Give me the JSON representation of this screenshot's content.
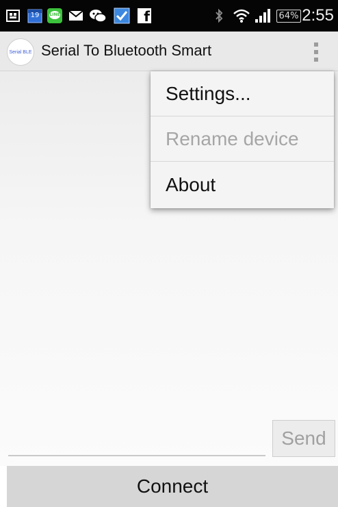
{
  "status_bar": {
    "calendar_day": "19",
    "line_label": "LINE",
    "facebook_glyph": "f",
    "battery": "64%",
    "time": "2:55",
    "icons": [
      "screenshot-icon",
      "calendar-icon",
      "line-app-icon",
      "mail-icon",
      "wechat-icon",
      "task-check-icon",
      "facebook-icon",
      "bluetooth-icon",
      "wifi-icon",
      "signal-icon",
      "battery-icon"
    ]
  },
  "app_bar": {
    "logo_text": "Serial BLE",
    "title": "Serial To Bluetooth Smart",
    "overflow_icon": "more-vertical-icon"
  },
  "menu": {
    "items": [
      {
        "label": "Settings...",
        "enabled": true
      },
      {
        "label": "Rename device",
        "enabled": false
      },
      {
        "label": "About",
        "enabled": true
      }
    ]
  },
  "compose": {
    "send_label": "Send"
  },
  "footer": {
    "connect_label": "Connect"
  },
  "colors": {
    "status_bar_bg": "#050505",
    "app_bar_bg": "#e9e9e9",
    "connect_bg": "#d6d6d6",
    "disabled_text": "#a6a6a6"
  }
}
